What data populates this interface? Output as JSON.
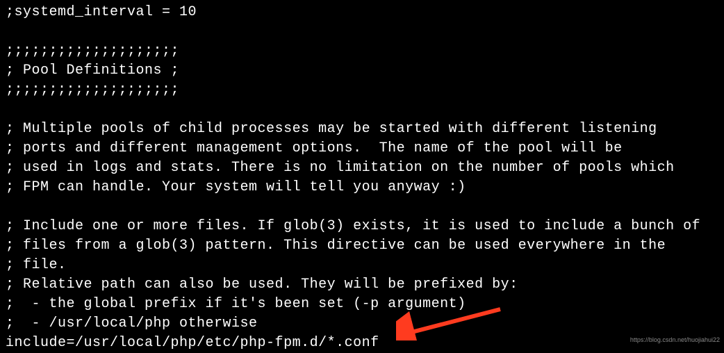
{
  "terminal": {
    "lines": [
      ";systemd_interval = 10",
      "",
      ";;;;;;;;;;;;;;;;;;;;",
      "; Pool Definitions ;",
      ";;;;;;;;;;;;;;;;;;;;",
      "",
      "; Multiple pools of child processes may be started with different listening",
      "; ports and different management options.  The name of the pool will be",
      "; used in logs and stats. There is no limitation on the number of pools which",
      "; FPM can handle. Your system will tell you anyway :)",
      "",
      "; Include one or more files. If glob(3) exists, it is used to include a bunch of",
      "; files from a glob(3) pattern. This directive can be used everywhere in the",
      "; file.",
      "; Relative path can also be used. They will be prefixed by:",
      ";  - the global prefix if it's been set (-p argument)",
      ";  - /usr/local/php otherwise",
      "include=/usr/local/php/etc/php-fpm.d/*.conf"
    ]
  },
  "annotation": {
    "arrow_color": "#ff3b1f"
  },
  "watermark": {
    "text": "https://blog.csdn.net/huojiahui22"
  }
}
